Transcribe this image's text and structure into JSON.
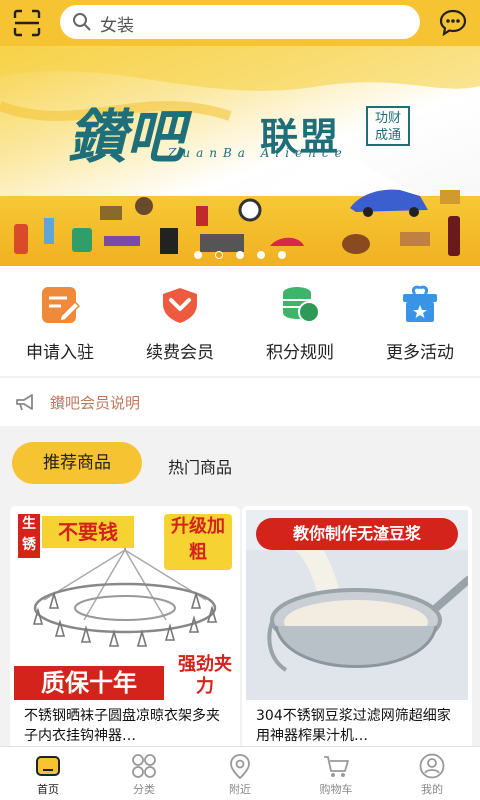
{
  "header": {
    "search_text": "女装"
  },
  "banner": {
    "title_1": "鑚吧",
    "title_2": "联盟",
    "tag": "功财\n成通",
    "subtitle": "ZuanBa  Alience",
    "slides": 5,
    "active_slide": 1
  },
  "quick_menu": [
    {
      "label": "申请入驻",
      "icon": "edit-icon",
      "color": "#f08a3b"
    },
    {
      "label": "续费会员",
      "icon": "chevron-down-heart-icon",
      "color": "#ee5a3f"
    },
    {
      "label": "积分规则",
      "icon": "coins-icon",
      "color": "#3cb56a"
    },
    {
      "label": "更多活动",
      "icon": "gift-icon",
      "color": "#3a94e6"
    }
  ],
  "notice": {
    "text": "鑚吧会员说明"
  },
  "tabs": {
    "active": "推荐商品",
    "other": "热门商品"
  },
  "products": [
    {
      "title": "不锈钢晒袜子圆盘凉晾衣架多夹子内衣挂钩神器…",
      "img_tag": "生锈",
      "img_head": "不要钱",
      "img_upgrade": "升级加粗",
      "img_warranty": "质保十年",
      "img_strong": "强劲夹力"
    },
    {
      "title": "304不锈钢豆浆过滤网筛超细家用神器榨果汁机…",
      "img_head": "教你制作无渣豆浆"
    }
  ],
  "bottom_nav": [
    {
      "label": "首页",
      "icon": "home-icon",
      "active": true
    },
    {
      "label": "分类",
      "icon": "grid-icon",
      "active": false
    },
    {
      "label": "附近",
      "icon": "location-icon",
      "active": false
    },
    {
      "label": "购物车",
      "icon": "cart-icon",
      "active": false
    },
    {
      "label": "我的",
      "icon": "user-icon",
      "active": false
    }
  ],
  "colors": {
    "brand": "#f6c333",
    "accent_red": "#d4231a",
    "teal": "#1f6f7a"
  }
}
